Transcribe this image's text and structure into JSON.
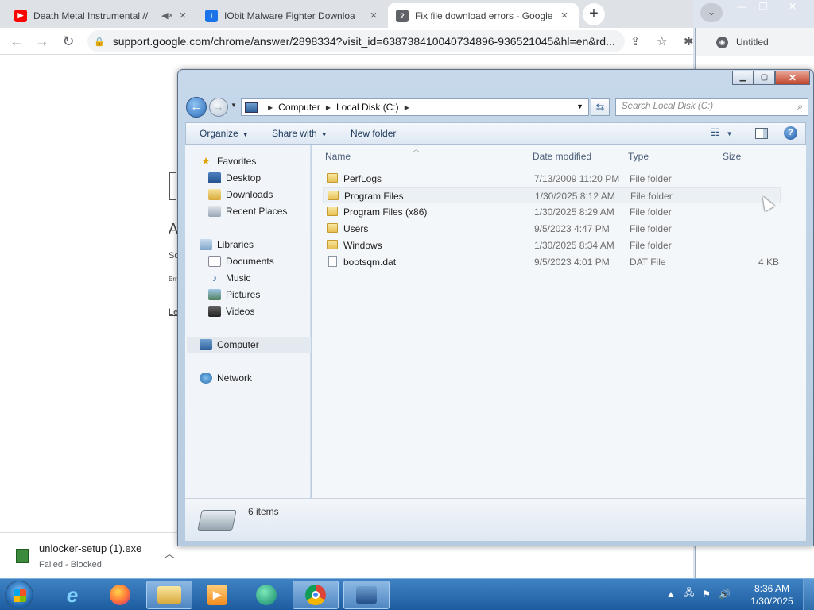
{
  "chrome": {
    "tabs": [
      {
        "title": "Death Metal Instrumental //",
        "favicon": "youtube-icon",
        "color": "#ff0000"
      },
      {
        "title": "IObit Malware Fighter Downloa",
        "favicon": "iobit-icon",
        "color": "#1a73e8"
      },
      {
        "title": "Fix file download errors - Google",
        "favicon": "google-help-icon",
        "color": "#5f6368"
      }
    ],
    "new_tab": "+",
    "url": "support.google.com/chrome/answer/2898334?visit_id=638738410040734896-936521045&hl=en&rd...",
    "page_fragments": {
      "a": "A",
      "b": "Sc",
      "c": "Err",
      "d": "Le"
    },
    "download": {
      "filename": "unlocker-setup (1).exe",
      "status": "Failed - Blocked"
    }
  },
  "background_window": {
    "tab_title": "Untitled"
  },
  "explorer": {
    "breadcrumb": [
      "Computer",
      "Local Disk (C:)"
    ],
    "search_placeholder": "Search Local Disk (C:)",
    "commands": {
      "organize": "Organize",
      "share": "Share with",
      "new_folder": "New folder"
    },
    "nav": {
      "favorites": "Favorites",
      "desktop": "Desktop",
      "downloads": "Downloads",
      "recent": "Recent Places",
      "libraries": "Libraries",
      "documents": "Documents",
      "music": "Music",
      "pictures": "Pictures",
      "videos": "Videos",
      "computer": "Computer",
      "network": "Network"
    },
    "columns": {
      "name": "Name",
      "date": "Date modified",
      "type": "Type",
      "size": "Size"
    },
    "files": [
      {
        "name": "PerfLogs",
        "date": "7/13/2009 11:20 PM",
        "type": "File folder",
        "size": ""
      },
      {
        "name": "Program Files",
        "date": "1/30/2025 8:12 AM",
        "type": "File folder",
        "size": ""
      },
      {
        "name": "Program Files (x86)",
        "date": "1/30/2025 8:29 AM",
        "type": "File folder",
        "size": ""
      },
      {
        "name": "Users",
        "date": "9/5/2023 4:47 PM",
        "type": "File folder",
        "size": ""
      },
      {
        "name": "Windows",
        "date": "1/30/2025 8:34 AM",
        "type": "File folder",
        "size": ""
      },
      {
        "name": "bootsqm.dat",
        "date": "9/5/2023 4:01 PM",
        "type": "DAT File",
        "size": "4 KB"
      }
    ],
    "item_count": "6 items"
  },
  "taskbar": {
    "time": "8:36 AM",
    "date": "1/30/2025"
  }
}
